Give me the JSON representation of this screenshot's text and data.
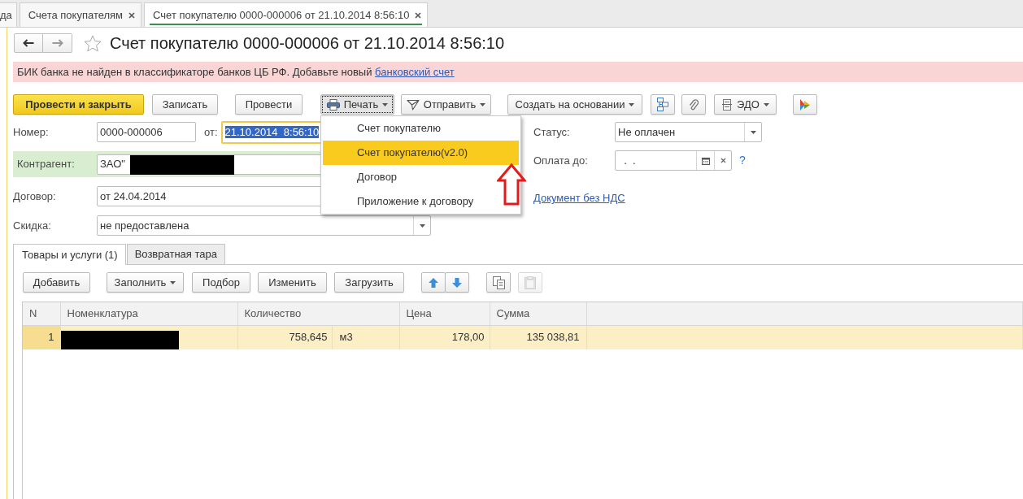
{
  "tab_bar": {
    "tabs": [
      {
        "label": "да",
        "selected": false,
        "closable": false
      },
      {
        "label": "Счета покупателям",
        "selected": false,
        "closable": true
      },
      {
        "label": "Счет покупателю 0000-000006 от 21.10.2014 8:56:10",
        "selected": true,
        "closable": true
      }
    ]
  },
  "header": {
    "title": "Счет покупателю 0000-000006 от 21.10.2014 8:56:10",
    "favorite": false
  },
  "message": {
    "text": "БИК банка не найден в классификаторе банков ЦБ РФ. Добавьте новый",
    "link": "банковский счет"
  },
  "toolbar": [
    {
      "kind": "primary",
      "label": "Провести и закрыть",
      "expanded": false
    },
    {
      "kind": "button",
      "label": "Записать",
      "expanded": false
    },
    {
      "kind": "button",
      "label": "Провести",
      "expanded": false
    },
    {
      "kind": "menu",
      "label": "Печать",
      "expanded": true
    },
    {
      "kind": "menu",
      "label": "Отправить",
      "expanded": false
    },
    {
      "kind": "menu",
      "label": "Создать на основании",
      "expanded": false
    },
    {
      "kind": "icon",
      "expanded": false
    },
    {
      "kind": "icon",
      "expanded": false
    },
    {
      "kind": "menu",
      "label": "ЭДО",
      "expanded": false
    },
    {
      "kind": "icon",
      "expanded": false
    }
  ],
  "print_menu": {
    "items": [
      {
        "label": "Счет покупателю",
        "selected": false
      },
      {
        "label": "Счет покупателю(v2.0)",
        "selected": true
      },
      {
        "label": "Договор",
        "selected": false
      },
      {
        "label": "Приложение к договору",
        "selected": false
      }
    ]
  },
  "form": {
    "number": {
      "label": "Номер:",
      "value": "0000-000006"
    },
    "date": {
      "label": "от:",
      "value": "21.10.2014  8:56:10",
      "focused": true
    },
    "counterparty": {
      "label": "Контрагент:",
      "value": "ЗАО\"",
      "highlighted": true,
      "redacted": true
    },
    "contract": {
      "label": "Договор:",
      "value": "от 24.04.2014"
    },
    "discount": {
      "label": "Скидка:",
      "value": "не предоставлена"
    },
    "status": {
      "label": "Статус:",
      "value": "Не оплачен"
    },
    "pay_until": {
      "label": "Оплата до:",
      "value": "  .  .",
      "help": "?"
    },
    "vat_link": "Документ без НДС"
  },
  "section_tabs": [
    {
      "label": "Товары и услуги (1)",
      "selected": true
    },
    {
      "label": "Возвратная тара",
      "selected": false
    }
  ],
  "table_toolbar": [
    {
      "kind": "button",
      "label": "Добавить",
      "disabled": false
    },
    {
      "kind": "menu",
      "label": "Заполнить",
      "disabled": false
    },
    {
      "kind": "button",
      "label": "Подбор",
      "disabled": false
    },
    {
      "kind": "button",
      "label": "Изменить",
      "disabled": false
    },
    {
      "kind": "button",
      "label": "Загрузить",
      "disabled": false
    },
    {
      "kind": "move_up",
      "disabled": false
    },
    {
      "kind": "move_down",
      "disabled": false
    },
    {
      "kind": "copy",
      "disabled": false
    },
    {
      "kind": "paste",
      "disabled": true
    }
  ],
  "table": {
    "columns": [
      "N",
      "Номенклатура",
      "Количество",
      "Цена",
      "Сумма"
    ],
    "rows": [
      {
        "n": "1",
        "redacted": true,
        "quantity": "758,645",
        "unit": "м3",
        "price": "178,00",
        "sum": "135 038,81",
        "selected": true
      }
    ]
  }
}
